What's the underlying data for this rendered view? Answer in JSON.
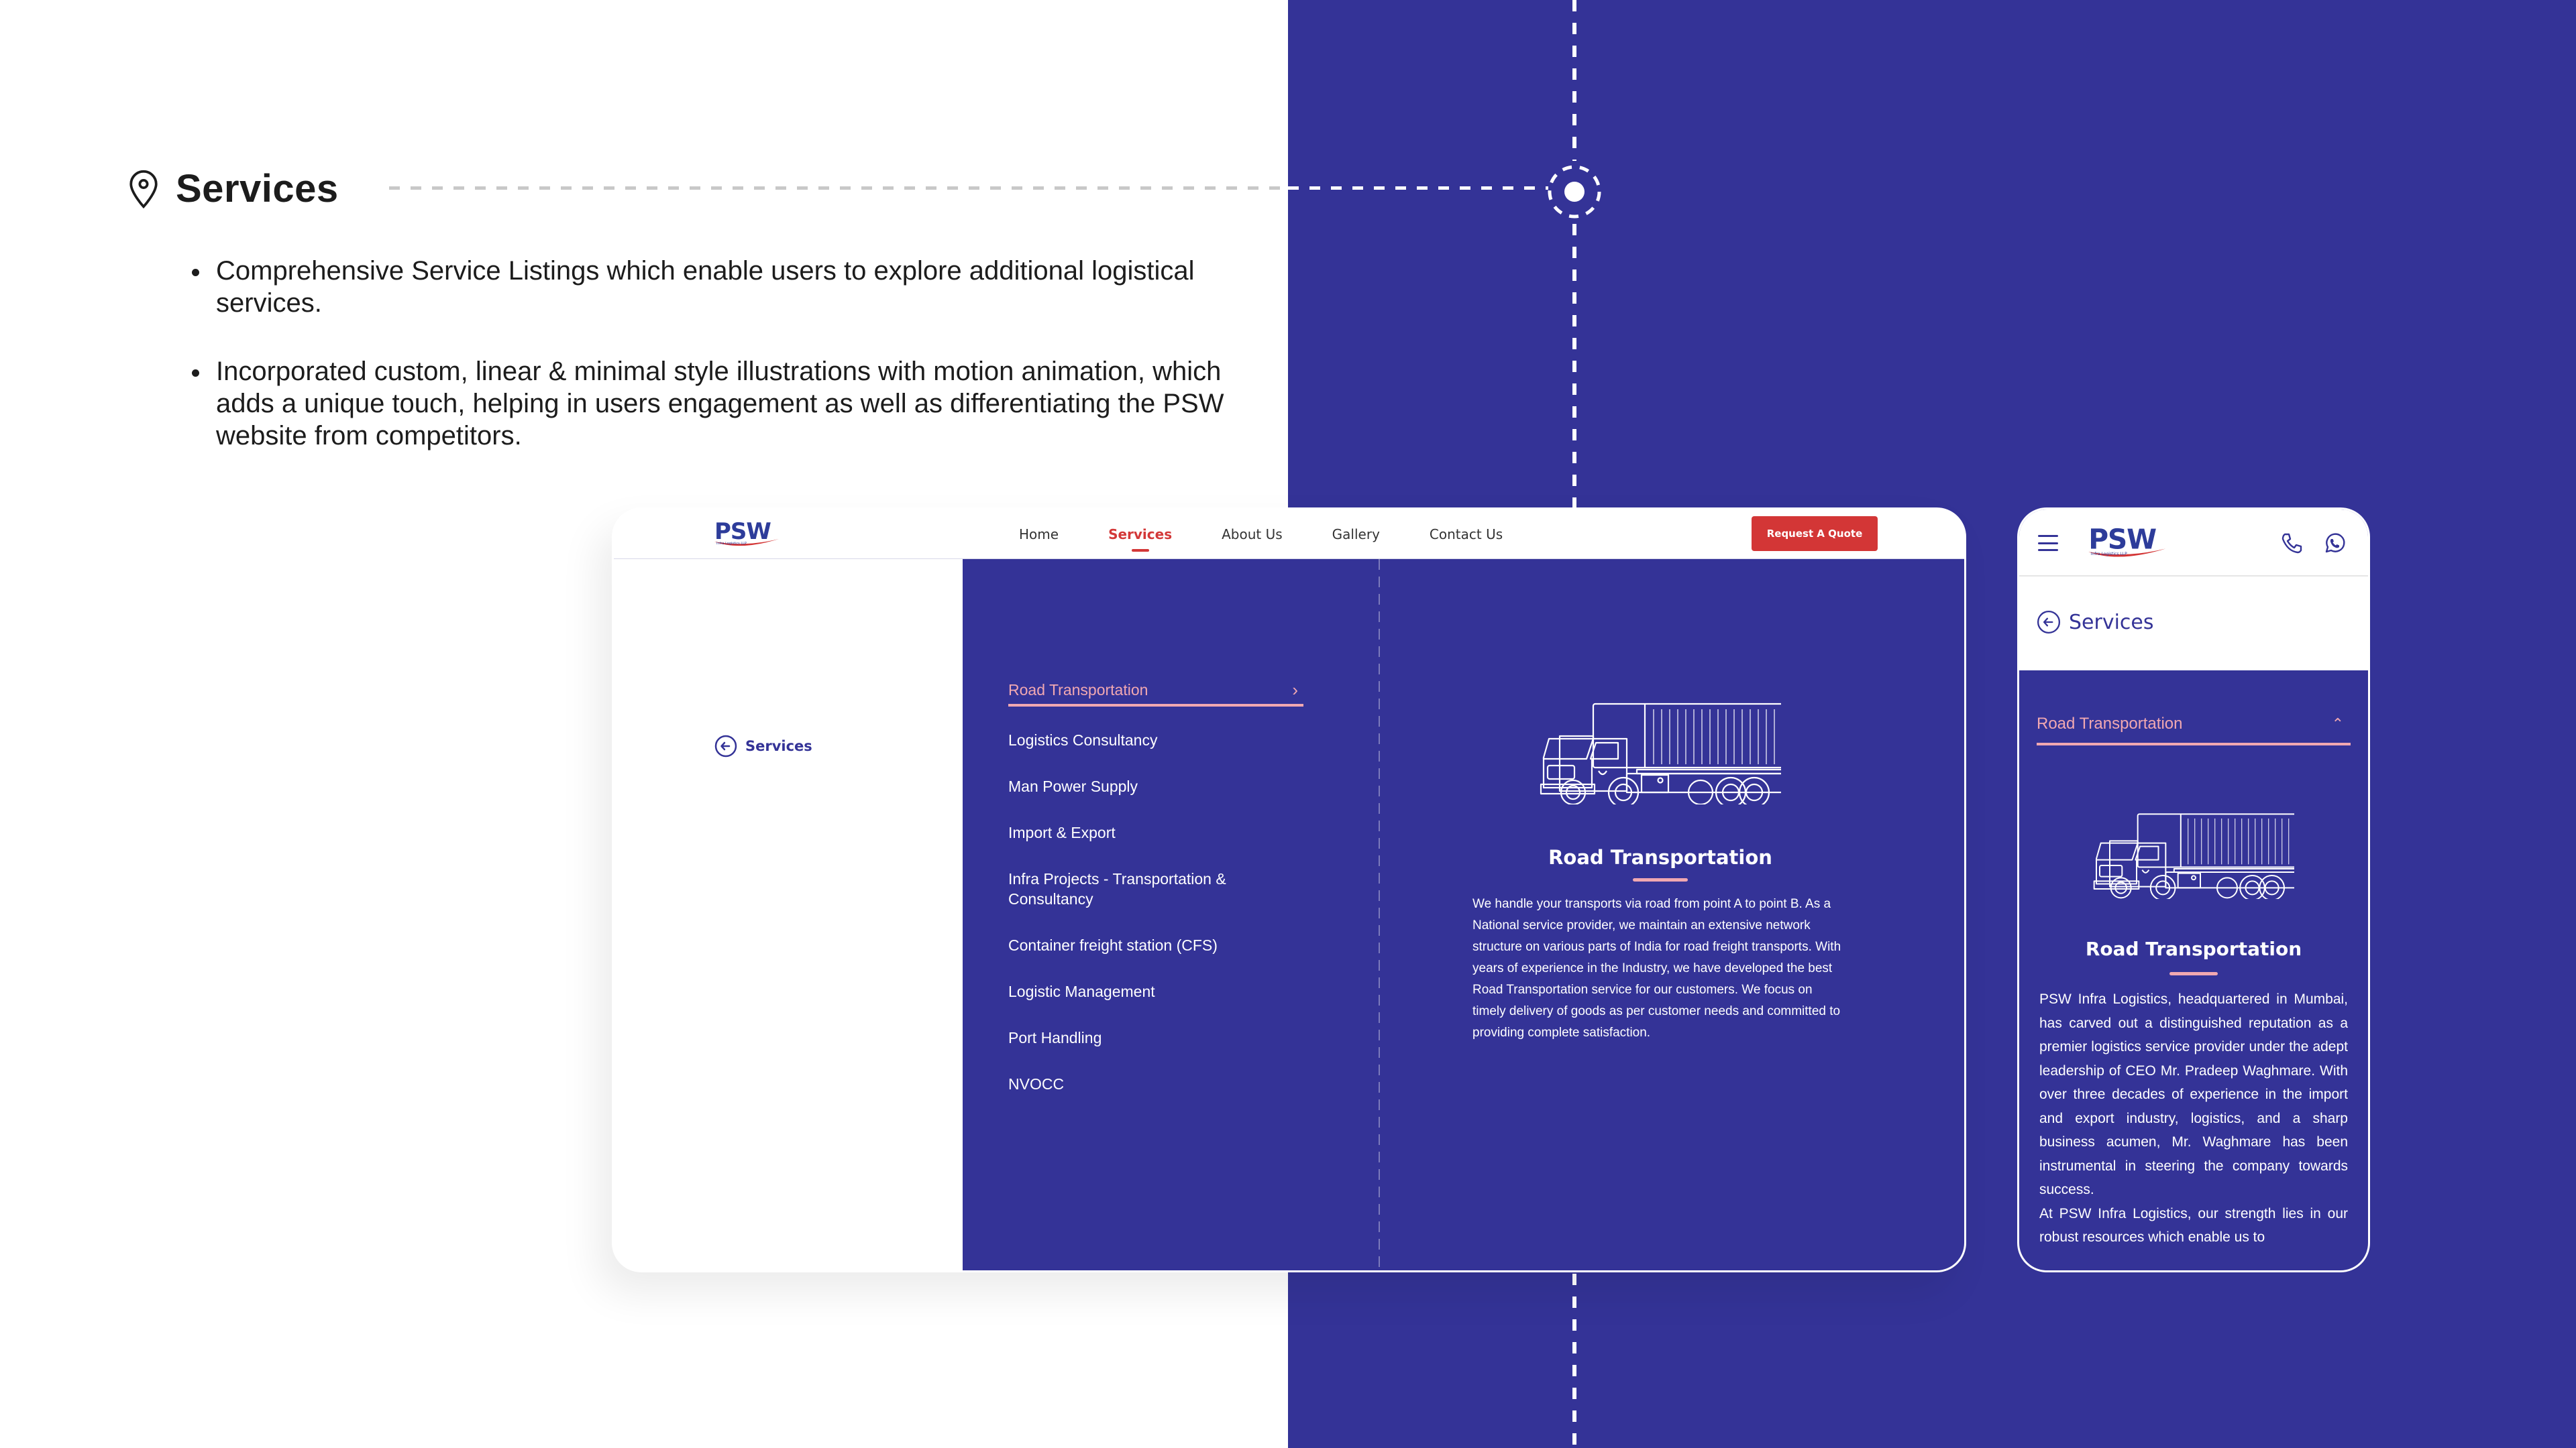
{
  "slide": {
    "heading": "Services",
    "heading_icon": "location-pin-icon",
    "bullets": [
      "Comprehensive Service Listings which enable users to explore additional logistical services.",
      "Incorporated custom, linear & minimal style illustrations with motion animation, which adds a unique touch, helping in users engagement as well as differentiating the PSW website from competitors."
    ],
    "colors": {
      "brand_blue": "#343397",
      "accent_red": "#d33636",
      "accent_pink": "#f1a8b1"
    }
  },
  "brand": {
    "logo_text": "PSW",
    "logo_subtext": "Infra Logistics LLP"
  },
  "desktop": {
    "nav": [
      {
        "label": "Home",
        "active": false
      },
      {
        "label": "Services",
        "active": true
      },
      {
        "label": "About Us",
        "active": false
      },
      {
        "label": "Gallery",
        "active": false
      },
      {
        "label": "Contact Us",
        "active": false
      }
    ],
    "cta_label": "Request A Quote",
    "back_label": "Services",
    "services": [
      "Road Transportation",
      "Logistics Consultancy",
      "Man Power Supply",
      "Import & Export",
      "Infra Projects - Transportation & Consultancy",
      "Container freight station (CFS)",
      "Logistic Management",
      "Port Handling",
      "NVOCC"
    ],
    "active_service_index": 0,
    "detail": {
      "illustration": "truck-illustration",
      "title": "Road Transportation",
      "body": "We handle your transports via road from point A to point B. As a National service provider, we maintain an extensive network structure on various parts of India for road freight transports. With years of experience in the Industry, we have developed the best Road Transportation service for our customers. We focus on timely delivery of goods as per customer needs and committed to providing complete satisfaction."
    }
  },
  "mobile": {
    "back_label": "Services",
    "accordion_label": "Road Transportation",
    "detail": {
      "title": "Road Transportation",
      "body": "PSW Infra Logistics, headquartered in Mumbai, has carved out a distinguished reputation as a premier logistics service provider under the adept leadership of CEO Mr. Pradeep Waghmare. With over three decades of experience in the import and export industry, logistics, and a sharp business acumen, Mr. Waghmare has been instrumental in steering the company towards success.",
      "body2": "At PSW Infra Logistics, our strength lies in our robust resources which enable us to"
    }
  }
}
